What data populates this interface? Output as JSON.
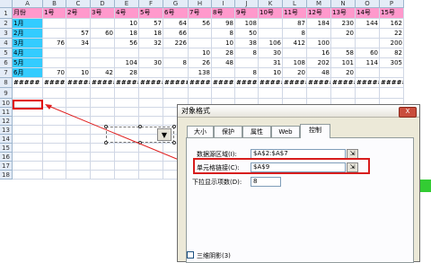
{
  "sheet": {
    "columns": [
      "A",
      "B",
      "C",
      "D",
      "E",
      "F",
      "G",
      "H",
      "I",
      "J",
      "K",
      "L",
      "M",
      "N",
      "O",
      "P"
    ],
    "rows": [
      "1",
      "2",
      "3",
      "4",
      "5",
      "6",
      "7",
      "8",
      "9",
      "10",
      "11",
      "12",
      "13",
      "14",
      "15",
      "16",
      "17",
      "18"
    ],
    "header_row": [
      "月份",
      "1号",
      "2号",
      "3号",
      "4号",
      "5号",
      "6号",
      "7号",
      "8号",
      "9号",
      "10号",
      "11号",
      "12号",
      "13号",
      "14号",
      "15号"
    ],
    "data_rows": [
      [
        "1月",
        "",
        "",
        "",
        "10",
        "57",
        "64",
        "56",
        "98",
        "108",
        "",
        "87",
        "184",
        "230",
        "144",
        "162"
      ],
      [
        "2月",
        "",
        "57",
        "60",
        "18",
        "18",
        "66",
        "",
        "8",
        "50",
        "",
        "8",
        "",
        "20",
        "",
        "22"
      ],
      [
        "3月",
        "76",
        "34",
        "",
        "56",
        "32",
        "226",
        "",
        "10",
        "38",
        "106",
        "412",
        "100",
        "",
        "",
        "200"
      ],
      [
        "4月",
        "",
        "",
        "",
        "",
        "",
        "",
        "10",
        "28",
        "8",
        "30",
        "",
        "16",
        "58",
        "60",
        "82"
      ],
      [
        "5月",
        "",
        "",
        "",
        "104",
        "30",
        "8",
        "26",
        "48",
        "",
        "31",
        "108",
        "202",
        "101",
        "114",
        "305"
      ],
      [
        "6月",
        "70",
        "10",
        "42",
        "28",
        "",
        "",
        "138",
        "",
        "8",
        "10",
        "20",
        "48",
        "20",
        "",
        ""
      ]
    ],
    "hash_row": [
      "#####",
      "#####",
      "#####",
      "#####",
      "#####",
      "#####",
      "#####",
      "#####",
      "#####",
      "#####",
      "#####",
      "#####",
      "#####",
      "#####",
      "#####",
      "#####"
    ]
  },
  "dialog": {
    "title": "对象格式",
    "close": "X",
    "tabs": [
      "大小",
      "保护",
      "属性",
      "Web",
      "控制"
    ],
    "active_tab": "控制",
    "source_label": "数据源区域(I):",
    "source_value": "$A$2:$A$7",
    "link_label": "单元格链接(C):",
    "link_value": "$A$9",
    "dropdown_label": "下拉显示项数(D):",
    "dropdown_value": "8",
    "shading_label": "三维阴影(3)",
    "ref_icon": "⇲"
  },
  "combo": {
    "arrow": "▼"
  },
  "colors": {
    "header_fill": "#ff99cc",
    "month_fill": "#33ccff",
    "highlight": "#d81d1d"
  }
}
